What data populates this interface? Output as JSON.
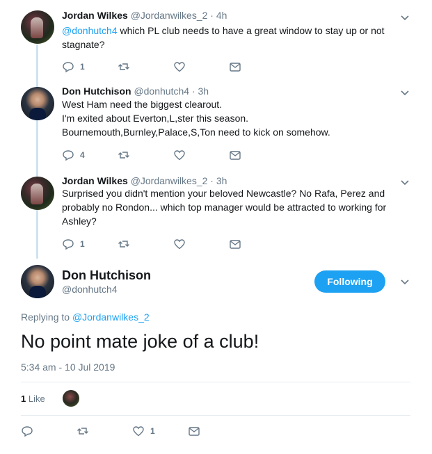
{
  "thread": [
    {
      "author": "jordan",
      "name": "Jordan Wilkes",
      "handle": "@Jordanwilkes_2",
      "separator": "·",
      "time": "4h",
      "mention": "@donhutch4",
      "text": " which PL club needs to have a great window to stay up or not stagnate?",
      "reply_count": "1",
      "retweet_count": "",
      "like_count": ""
    },
    {
      "author": "don",
      "name": "Don Hutchison",
      "handle": "@donhutch4",
      "separator": "·",
      "time": "3h",
      "lines": [
        "West Ham need the biggest clearout.",
        "I'm exited about Everton,L,ster this season.",
        "Bournemouth,Burnley,Palace,S,Ton need to kick on somehow."
      ],
      "reply_count": "4",
      "retweet_count": "",
      "like_count": ""
    },
    {
      "author": "jordan",
      "name": "Jordan Wilkes",
      "handle": "@Jordanwilkes_2",
      "separator": "·",
      "time": "3h",
      "text": "Surprised you didn't mention your beloved Newcastle? No Rafa, Perez and probably no Rondon... which top manager would be attracted to working for Ashley?",
      "reply_count": "1",
      "retweet_count": "",
      "like_count": ""
    }
  ],
  "main": {
    "name": "Don Hutchison",
    "handle": "@donhutch4",
    "follow_label": "Following",
    "replying_prefix": "Replying to ",
    "replying_handle": "@Jordanwilkes_2",
    "text": "No point mate joke of a club!",
    "timestamp": "5:34 am - 10 Jul 2019",
    "likes_count": "1",
    "likes_label": " Like",
    "reply_count": "",
    "retweet_count": "",
    "like_count": "1"
  },
  "colors": {
    "accent": "#1da1f2",
    "muted": "#657786",
    "thread_line": "#cfe3f0"
  },
  "icons": [
    "reply-icon",
    "retweet-icon",
    "heart-icon",
    "mail-icon",
    "chevron-down-icon"
  ]
}
